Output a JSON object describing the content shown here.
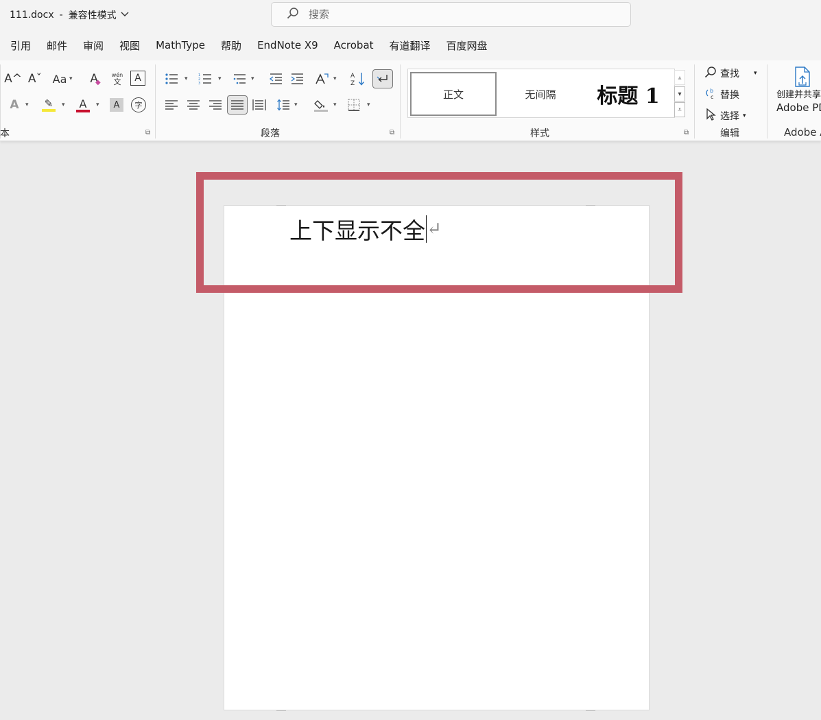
{
  "titlebar": {
    "filename": "111.docx",
    "separator": "-",
    "mode": "兼容性模式",
    "mode_chevron": "chevron-down",
    "search_placeholder": "搜索"
  },
  "menu": {
    "tabs": [
      "引用",
      "邮件",
      "审阅",
      "视图",
      "MathType",
      "帮助",
      "EndNote X9",
      "Acrobat",
      "有道翻译",
      "百度网盘"
    ]
  },
  "ribbon": {
    "font_group_label": "本",
    "paragraph_group_label": "段落",
    "styles_group_label": "样式",
    "editing_group_label": "编辑",
    "adobe_group_label": "Adobe A",
    "font_icons": {
      "grow_font": "A^",
      "shrink_font": "Aˇ",
      "change_case": "Aa",
      "clear_format": "A",
      "phonetic_top": "wén",
      "phonetic_bottom": "文",
      "char_border": "A",
      "text_effect": "A",
      "highlight": "✎",
      "font_color": "A",
      "char_shading": "A",
      "enclose_char": "字"
    },
    "styles": {
      "normal": "正文",
      "no_spacing": "无间隔",
      "heading1": "标题 1"
    },
    "editing": {
      "find": "查找",
      "replace": "替换",
      "select": "选择"
    },
    "adobe": {
      "line1": "创建并共享",
      "line2": "Adobe PDF"
    },
    "colors": {
      "highlight_yellow": "#f5e83a",
      "font_red": "#c8102e",
      "accent_blue": "#2b78c5"
    }
  },
  "document": {
    "text": "上下显示不全",
    "paragraph_mark": "↵"
  },
  "annotation": {
    "box_color": "#c45b68"
  }
}
